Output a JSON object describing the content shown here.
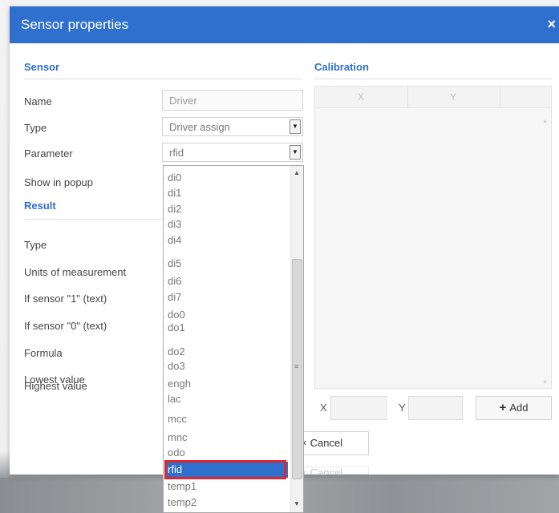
{
  "dialog": {
    "title": "Sensor properties",
    "close_icon": "×"
  },
  "colors": {
    "header": "#2f6fcd",
    "selected_item": "#2f6fcd",
    "highlight_border": "#e0262c"
  },
  "sensor": {
    "heading": "Sensor",
    "name_label": "Name",
    "name_value": "Driver",
    "type_label": "Type",
    "type_value": "Driver assign",
    "parameter_label": "Parameter",
    "parameter_value": "rfid",
    "show_in_popup_label": "Show in popup"
  },
  "result": {
    "heading": "Result",
    "type_label": "Type",
    "units_label": "Units of measurement",
    "if_1_label": "If sensor \"1\" (text)",
    "if_0_label": "If sensor \"0\" (text)",
    "formula_label": "Formula",
    "lowest_label": "Lowest value",
    "highest_label": "Highest value"
  },
  "calibration": {
    "heading": "Calibration",
    "columns": [
      "X",
      "Y"
    ],
    "x_label": "X",
    "y_label": "Y",
    "add_label": "Add",
    "add_icon": "+"
  },
  "buttons": {
    "cancel_label": "Cancel",
    "cancel_icon": "×",
    "cancel_secondary_label": "Cancel"
  },
  "parameter_dropdown": {
    "selected": "rfid",
    "options": [
      "di0",
      "di1",
      "di2",
      "di3",
      "di4",
      "di5",
      "di6",
      "di7",
      "do0",
      "do1",
      "do2",
      "do3",
      "engh",
      "lac",
      "mcc",
      "mnc",
      "odo",
      "rfid",
      "temp1",
      "temp2"
    ]
  }
}
